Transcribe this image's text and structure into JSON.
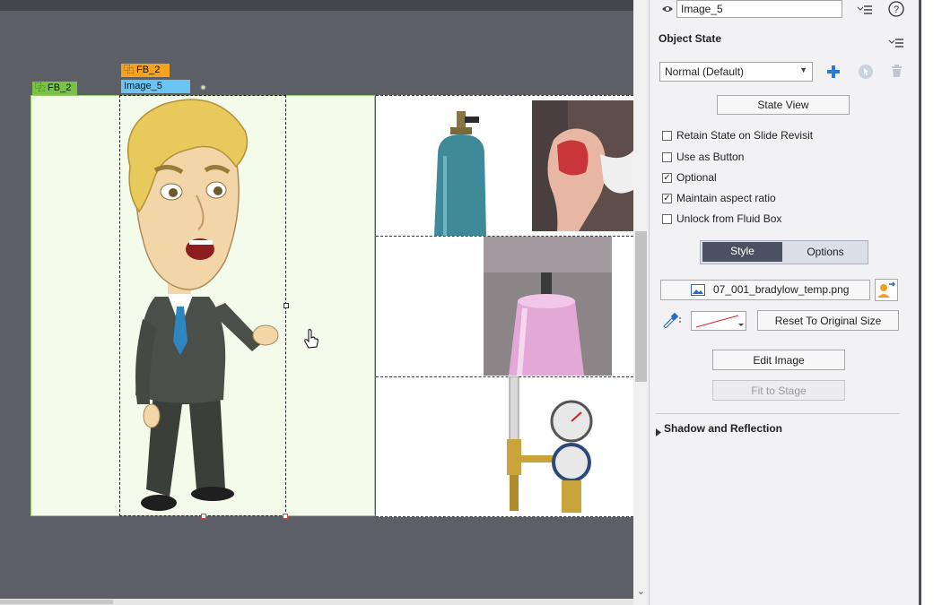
{
  "stage": {
    "tags": {
      "fluid_box_outer": "⿻ FB_2",
      "fluid_box_inner": "⿻ FB_2",
      "selected_object": "Image_5"
    }
  },
  "panel": {
    "object_name": "Image_5",
    "object_state": {
      "title": "Object State",
      "state_value": "Normal (Default)",
      "state_view_label": "State View"
    },
    "checkboxes": [
      {
        "label": "Retain State on Slide Revisit",
        "checked": false,
        "mark": ""
      },
      {
        "label": "Use as Button",
        "checked": false,
        "mark": ""
      },
      {
        "label": "Optional",
        "checked": true,
        "mark": "✓"
      },
      {
        "label": "Maintain aspect ratio",
        "checked": true,
        "mark": "✓"
      },
      {
        "label": "Unlock from Fluid Box",
        "checked": false,
        "mark": ""
      }
    ],
    "tabs": {
      "style_label": "Style",
      "options_label": "Options",
      "active": "Style"
    },
    "image_file": "07_001_bradylow_temp.png",
    "reset_size_label": "Reset To Original Size",
    "edit_image_label": "Edit Image",
    "fit_to_stage_label": "Fit to Stage",
    "shadow_section_label": "Shadow and Reflection"
  },
  "colors": {
    "accent_blue": "#2a7bd6",
    "tab_active_bg": "#4a5163",
    "fluid_box_tag": "#76c442",
    "inner_box_tag": "#f5a21e",
    "object_tag": "#6ac5f2"
  }
}
